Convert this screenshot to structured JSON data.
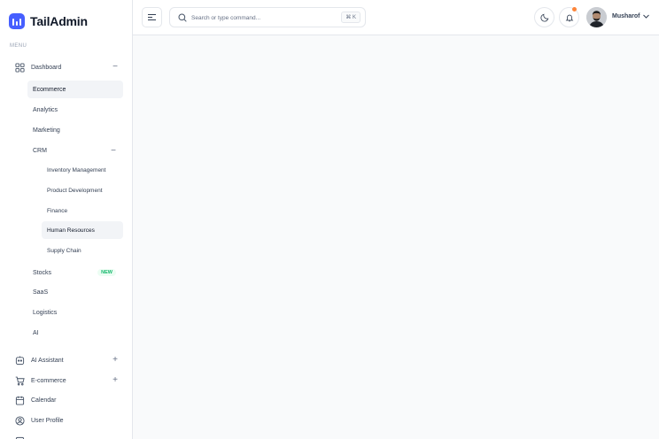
{
  "brand": {
    "name": "TailAdmin",
    "accent": "#465fff"
  },
  "sidebar": {
    "menu_label": "MENU",
    "dashboard": {
      "label": "Dashboard",
      "toggle": "−",
      "items": {
        "ecommerce": "Ecommerce",
        "analytics": "Analytics",
        "marketing": "Marketing",
        "crm": {
          "label": "CRM",
          "toggle": "−",
          "items": {
            "inventory": "Inventory Management",
            "product_dev": "Product Development",
            "finance": "Finance",
            "hr": "Human Resources",
            "supply": "Supply Chain"
          }
        },
        "stocks": {
          "label": "Stocks",
          "badge": "NEW"
        },
        "saas": "SaaS",
        "logistics": "Logistics",
        "ai": "AI"
      }
    },
    "ai_assistant": {
      "label": "AI Assistant",
      "toggle": "+"
    },
    "ecommerce": {
      "label": "E-commerce",
      "toggle": "+"
    },
    "calendar": {
      "label": "Calendar"
    },
    "user_profile": {
      "label": "User Profile"
    }
  },
  "header": {
    "search": {
      "placeholder": "Search or type command...",
      "shortcut": "⌘ K"
    },
    "user": {
      "name": "Musharof"
    },
    "notification_dot_color": "#fd853a"
  }
}
